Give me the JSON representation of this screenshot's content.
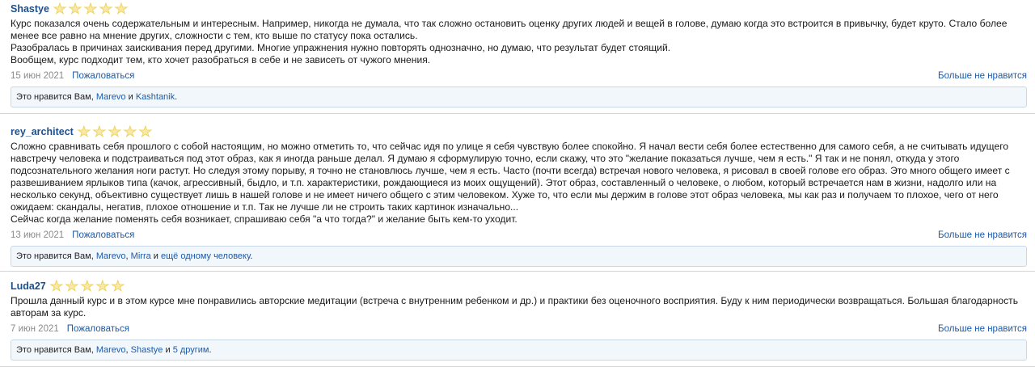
{
  "reviews": [
    {
      "author": "Shastye",
      "rating": 5,
      "paragraphs": [
        "Курс показался очень содержательным и интересным. Например, никогда не думала, что так сложно остановить оценку других людей и вещей в голове, думаю когда это встроится в привычку, будет круто. Стало более менее все равно на мнение других, сложности с тем, кто выше по статусу пока остались.",
        "Разобралась в причинах заискивания перед другими. Многие упражнения нужно повторять однозначно, но думаю, что результат будет стоящий.",
        "Вообщем, курс подходит тем, кто хочет разобраться в себе и не зависеть от чужого мнения."
      ],
      "date": "15 июн 2021",
      "report": "Пожаловаться",
      "unlike": "Больше не нравится",
      "likes": {
        "prefix": "Это нравится Вам, ",
        "users": [
          "Marevo",
          "Kashtanik"
        ],
        "sep1": " и ",
        "suffix": "."
      }
    },
    {
      "author": "rey_architect",
      "rating": 5,
      "paragraphs": [
        "Сложно сравнивать себя прошлого с собой настоящим, но можно отметить то, что сейчас идя по улице я себя чувствую более спокойно. Я начал вести себя более естественно для самого себя, а не считывать идущего навстречу человека и подстраиваться под этот образ, как я иногда раньше делал. Я думаю я сформулирую точно, если скажу, что это \"желание показаться лучше, чем я есть.\" Я так и не понял, откуда у этого подсознательного желания ноги растут. Но следуя этому порыву, я точно не становлюсь лучше, чем я есть. Часто (почти всегда) встречая нового человека, я рисовал в своей голове его образ. Это много общего имеет с развешиванием ярлыков типа (качок, агрессивный, быдло, и т.п. характеристики, рождающиеся из моих ощущений). Этот образ, составленный о человеке, о любом, который встречается нам в жизни, надолго или на несколько секунд, объективно существует лишь в нашей голове и не имеет ничего общего с этим человеком. Хуже то, что если мы держим в голове этот образ человека, мы как раз и получаем то плохое, чего от него ожидаем: скандалы, негатив, плохое отношение и т.п. Так не лучше ли не строить таких картинок изначально...",
        "Сейчас когда желание поменять себя возникает, спрашиваю себя \"а что тогда?\" и желание быть кем-то уходит."
      ],
      "date": "13 июн 2021",
      "report": "Пожаловаться",
      "unlike": "Больше не нравится",
      "likes": {
        "prefix": "Это нравится Вам, ",
        "users": [
          "Marevo",
          "Mirra"
        ],
        "sep1": ", ",
        "sep2": " и ",
        "more": "ещё одному человеку",
        "suffix": "."
      }
    },
    {
      "author": "Luda27",
      "rating": 5,
      "paragraphs": [
        "Прошла данный курс и в этом курсе мне понравились авторские медитации (встреча с внутренним ребенком и др.) и практики без оценочного восприятия. Буду к ним периодически возвращаться. Большая благодарность авторам за курс."
      ],
      "date": "7 июн 2021",
      "report": "Пожаловаться",
      "unlike": "Больше не нравится",
      "likes": {
        "prefix": "Это нравится Вам, ",
        "users": [
          "Marevo",
          "Shastye"
        ],
        "sep1": ", ",
        "sep2": " и ",
        "more": "5 другим",
        "suffix": "."
      }
    }
  ],
  "colors": {
    "link": "#1c5aa8",
    "author": "#1c4f8c",
    "star": "#f0d35c",
    "likes_bg": "#f2f7fc"
  }
}
